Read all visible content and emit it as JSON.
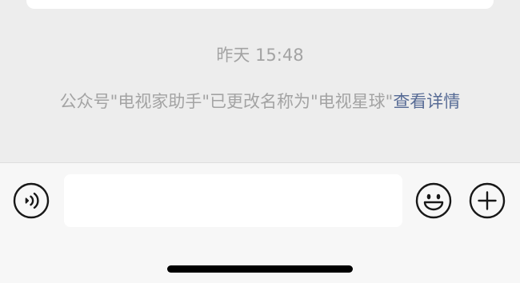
{
  "chat": {
    "timestamp": "昨天 15:48",
    "system_message": {
      "text": "公众号\"电视家助手\"已更改名称为\"电视星球\"",
      "link": "查看详情"
    }
  },
  "input_bar": {
    "input_value": "",
    "icons": {
      "voice": "voice-icon",
      "emoji": "emoji-icon",
      "more": "plus-icon"
    }
  },
  "colors": {
    "background": "#ededed",
    "input_bar_background": "#f7f7f7",
    "muted_text": "#a3a3a3",
    "link": "#576b95",
    "icon_stroke": "#181818"
  }
}
